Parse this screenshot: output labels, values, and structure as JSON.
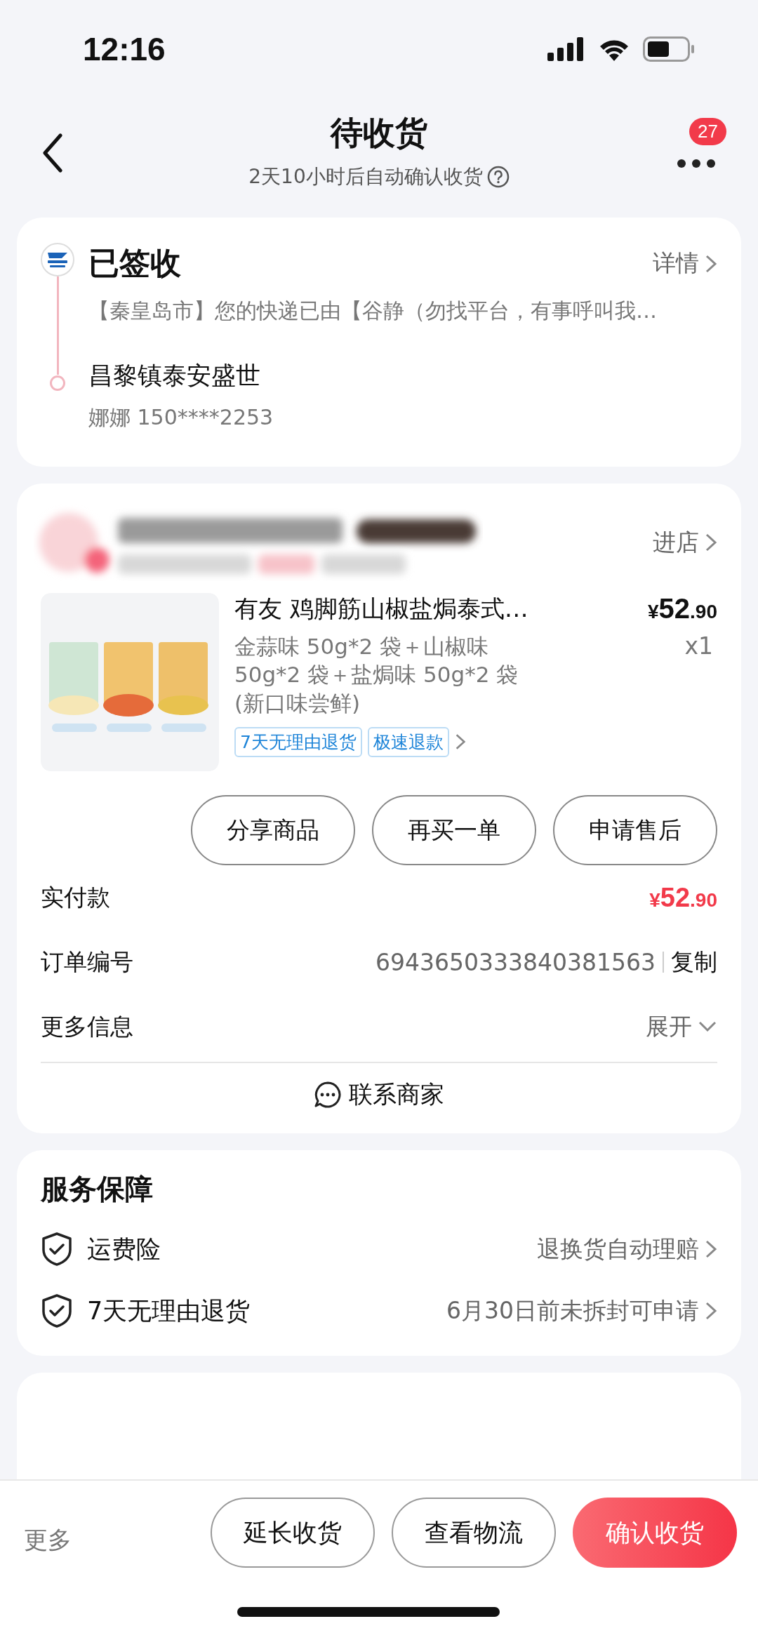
{
  "status_bar": {
    "time": "12:16"
  },
  "header": {
    "title": "待收货",
    "subtitle": "2天10小时后自动确认收货",
    "badge": "27"
  },
  "tracking": {
    "status": "已签收",
    "detail_link": "详情",
    "message": "【秦皇岛市】您的快递已由【谷静（勿找平台，有事呼叫我…",
    "address": "昌黎镇泰安盛世",
    "contact": "娜娜 150****2253"
  },
  "store": {
    "enter_link": "进店"
  },
  "product": {
    "title": "有友 鸡脚筋山椒盐焗泰式…",
    "spec": "金蒜味 50g*2 袋＋山椒味 50g*2 袋＋盐焗味 50g*2 袋 (新口味尝鲜)",
    "price": {
      "symbol": "¥",
      "main": "52",
      "cents": ".90"
    },
    "quantity": "x1",
    "tags": [
      "7天无理由退货",
      "极速退款"
    ]
  },
  "actions": [
    "分享商品",
    "再买一单",
    "申请售后"
  ],
  "order_info": [
    {
      "kind": "price",
      "label": "实付款",
      "symbol": "¥",
      "main": "52",
      "cents": ".90"
    },
    {
      "kind": "copy",
      "label": "订单编号",
      "value": "6943650333840381563",
      "action": "复制"
    },
    {
      "kind": "expand",
      "label": "更多信息",
      "action": "展开"
    }
  ],
  "contact_merchant": "联系商家",
  "services": {
    "title": "服务保障",
    "items": [
      {
        "name": "运费险",
        "detail": "退换货自动理赔"
      },
      {
        "name": "7天无理由退货",
        "detail": "6月30日前未拆封可申请"
      }
    ]
  },
  "bottom_bar": {
    "more": "更多",
    "buttons": [
      {
        "label": "延长收货",
        "kind": "outline"
      },
      {
        "label": "查看物流",
        "kind": "outline"
      },
      {
        "label": "确认收货",
        "kind": "primary"
      }
    ]
  }
}
